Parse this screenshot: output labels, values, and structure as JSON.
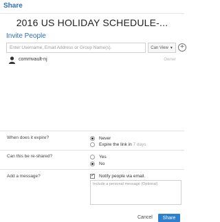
{
  "dialog": {
    "header": "Share",
    "title": "2016 US HOLIDAY SCHEDULE-..."
  },
  "invite": {
    "label": "Invite People",
    "placeholder": "Enter Username, Email Address or Group Name(s).",
    "permission": "Can View",
    "add_icon": "plus-circle-icon"
  },
  "users": [
    {
      "name": "commvault-nj",
      "role": "Owner",
      "icon": "user-icon"
    }
  ],
  "expiry": {
    "question": "When does it expire?",
    "options": [
      {
        "label": "Never",
        "selected": true
      },
      {
        "label": "Expire the link in",
        "suffix": "7 days",
        "selected": false
      }
    ]
  },
  "reshare": {
    "question": "Can this be re-shared?",
    "options": [
      {
        "label": "Yes",
        "selected": false
      },
      {
        "label": "No",
        "selected": true
      }
    ]
  },
  "message": {
    "question": "Add a message?",
    "notify_label": "Notify people via email.",
    "notify_checked": true,
    "placeholder": "Include a personal message (Optional)"
  },
  "buttons": {
    "cancel": "Cancel",
    "share": "Share"
  },
  "colors": {
    "accent": "#2a6ebb",
    "share_button": "#2f7fd0"
  }
}
